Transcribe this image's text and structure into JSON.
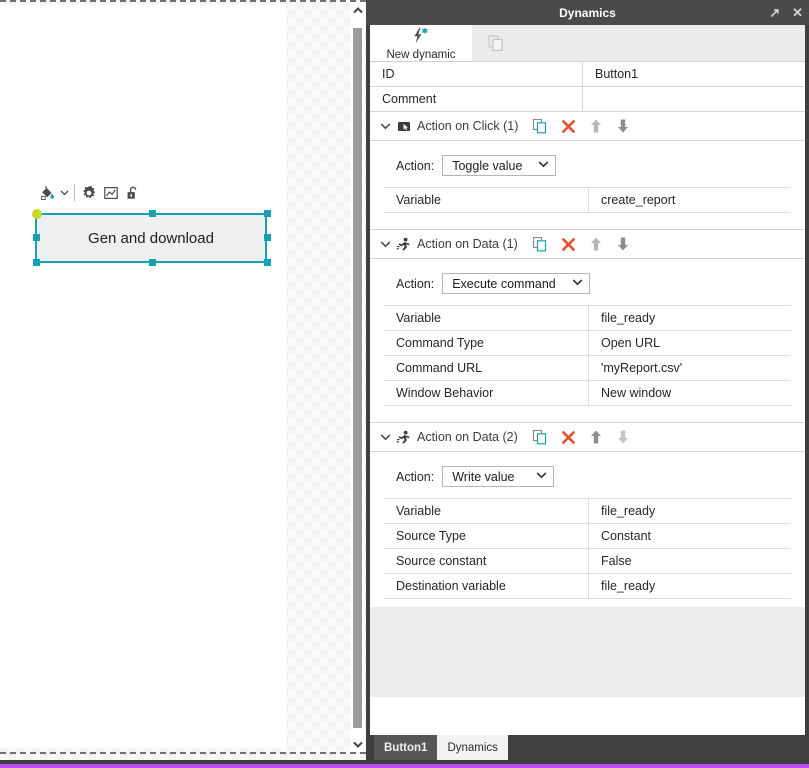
{
  "canvas": {
    "element_toolbar": [
      {
        "icon": "paint-bucket-icon",
        "label": "Fill color"
      },
      {
        "icon": "chevron-down-icon",
        "label": "Fill color options"
      },
      {
        "icon": "gear-icon",
        "label": "Settings"
      },
      {
        "icon": "chart-icon",
        "label": "Chart"
      },
      {
        "icon": "unlock-icon",
        "label": "Unlocked"
      }
    ],
    "selected_element": {
      "label": "Gen and download",
      "selection_color": "#17a2b2",
      "rotate_handle_color": "#c8d92b"
    },
    "scrollbar": {
      "up_arrow": "chevron-up-icon",
      "down_arrow": "chevron-down-icon"
    }
  },
  "panel": {
    "title": "Dynamics",
    "title_buttons": [
      {
        "icon": "popout-icon",
        "glyph": "↗"
      },
      {
        "icon": "close-icon",
        "glyph": "✕"
      }
    ],
    "toolbar_tabs": {
      "new_dynamic_label": "New dynamic",
      "new_dynamic_icon": "lightning-new-icon",
      "duplicate_icon": "duplicate-icon"
    },
    "properties": [
      {
        "key": "ID",
        "value": "Button1"
      },
      {
        "key": "Comment",
        "value": ""
      }
    ],
    "action_tools": {
      "duplicate_icon": "duplicate-icon",
      "delete_icon": "delete-x-icon",
      "move_up_icon": "arrow-up-icon",
      "move_down_icon": "arrow-down-icon",
      "collapse_icon": "chevron-down-icon"
    },
    "sections": [
      {
        "title": "Action on Click (1)",
        "type_icon": "click-cursor-icon",
        "expanded": true,
        "action_label": "Action:",
        "action_value": "Toggle value",
        "move_up_enabled": false,
        "move_down_enabled": true,
        "rows": [
          {
            "key": "Variable",
            "value": "create_report"
          }
        ]
      },
      {
        "title": "Action on Data (1)",
        "type_icon": "running-person-icon",
        "expanded": true,
        "action_label": "Action:",
        "action_value": "Execute command",
        "move_up_enabled": false,
        "move_down_enabled": true,
        "rows": [
          {
            "key": "Variable",
            "value": "file_ready"
          },
          {
            "key": "Command Type",
            "value": "Open URL"
          },
          {
            "key": "Command URL",
            "value": "'myReport.csv'"
          },
          {
            "key": "Window Behavior",
            "value": "New window"
          }
        ]
      },
      {
        "title": "Action on Data (2)",
        "type_icon": "running-person-icon",
        "expanded": true,
        "action_label": "Action:",
        "action_value": "Write value",
        "move_up_enabled": true,
        "move_down_enabled": false,
        "rows": [
          {
            "key": "Variable",
            "value": "file_ready"
          },
          {
            "key": "Source Type",
            "value": "Constant"
          },
          {
            "key": "Source constant",
            "value": "False"
          },
          {
            "key": "Destination variable",
            "value": "file_ready"
          }
        ]
      }
    ],
    "bottom_tabs": [
      {
        "label": "Button1",
        "active": false
      },
      {
        "label": "Dynamics",
        "active": true
      }
    ]
  },
  "colors": {
    "accent_teal": "#17a2b2",
    "delete_orange": "#e8522e",
    "panel_dark": "#3f3f3f",
    "bottom_accent_purple": "#b44df0"
  }
}
